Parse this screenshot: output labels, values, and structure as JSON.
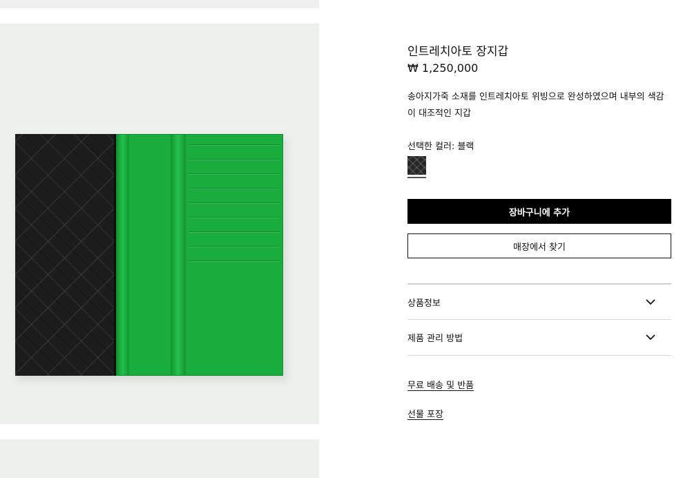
{
  "product": {
    "title": "인트레치아토 장지갑",
    "price": "₩ 1,250,000",
    "description": "송아지가죽 소재를 인트레치아토 위빙으로 완성하였으며 내부의 색감이 대조적인 지갑",
    "selected_color_label": "선택한 컬러: 블랙",
    "swatch_color": "#262626"
  },
  "actions": {
    "add_to_cart": "장바구니에 추가",
    "find_in_store": "매장에서 찾기"
  },
  "accordion": [
    {
      "label": "상품정보",
      "icon": "chevron-down-icon"
    },
    {
      "label": "제품 관리 방법",
      "icon": "chevron-down-icon"
    }
  ],
  "links": {
    "shipping": "무료 배송 및 반품",
    "gift": "선물 포장"
  },
  "colors": {
    "gallery_bg": "#eef0ee",
    "leather_black": "#1c1c1c",
    "interior_green": "#19ad3e",
    "button_black": "#000000"
  }
}
